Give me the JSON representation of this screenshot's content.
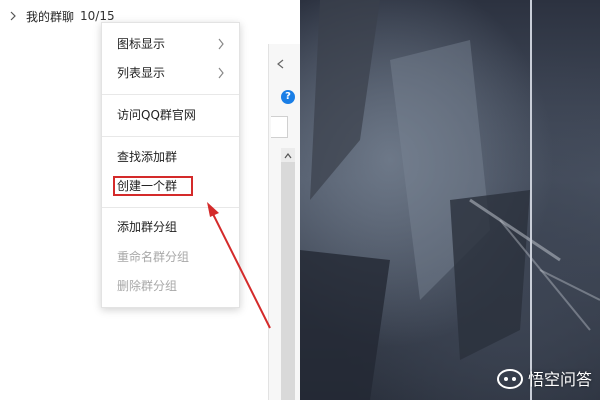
{
  "group_list": {
    "group_name": "我的群聊",
    "group_count": "10/15"
  },
  "context_menu": {
    "icon_view": "图标显示",
    "list_view": "列表显示",
    "visit_site": "访问QQ群官网",
    "find_add_group": "查找添加群",
    "create_group": "创建一个群",
    "add_category": "添加群分组",
    "rename_category": "重命名群分组",
    "delete_category": "删除群分组"
  },
  "dialog": {
    "help_glyph": "?"
  },
  "annotation": {
    "highlight_color": "#d42a2a",
    "arrow_color": "#d42a2a"
  },
  "watermark": {
    "text": "悟空问答"
  }
}
